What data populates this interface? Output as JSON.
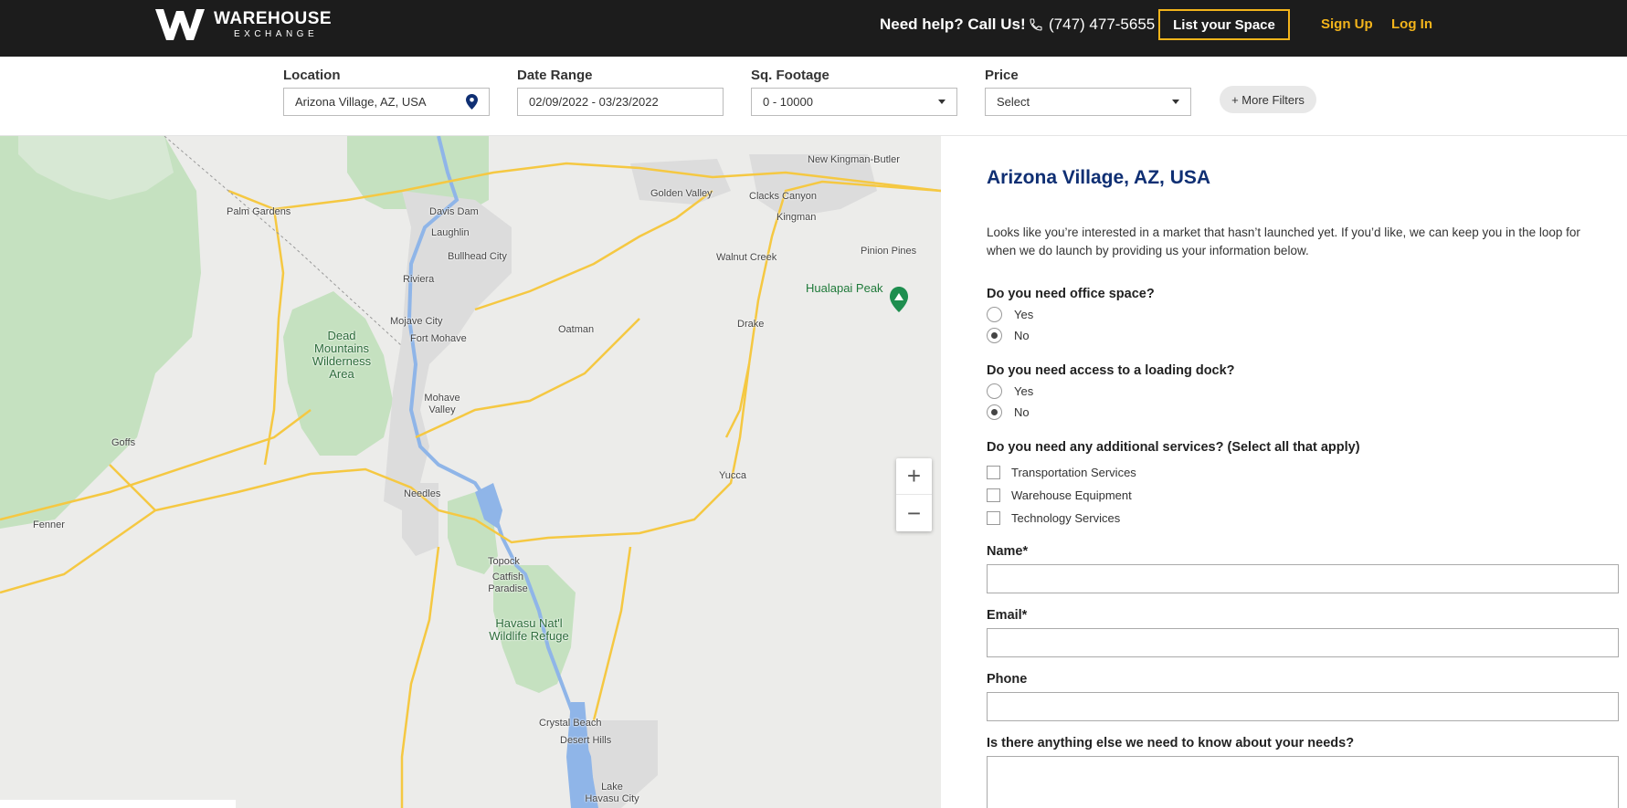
{
  "header": {
    "logo_line1": "WAREHOUSE",
    "logo_line2": "EXCHANGE",
    "help_text": "Need help? Call Us!",
    "phone": "(747) 477-5655",
    "list_space_label": "List your Space",
    "signup_label": "Sign Up",
    "login_label": "Log In",
    "accent_color": "#f3b41b"
  },
  "filters": {
    "location": {
      "label": "Location",
      "value": "Arizona Village, AZ, USA",
      "icon": "map-pin-icon"
    },
    "date_range": {
      "label": "Date Range",
      "value": "02/09/2022 - 03/23/2022"
    },
    "sq_footage": {
      "label": "Sq. Footage",
      "value": "0 - 10000"
    },
    "price": {
      "label": "Price",
      "value": "Select"
    },
    "more_filters_label": "+ More Filters"
  },
  "map": {
    "labels": {
      "new_kingman_butler": "New Kingman-Butler",
      "golden_valley": "Golden Valley",
      "clacks_canyon": "Clacks Canyon",
      "kingman": "Kingman",
      "palm_gardens": "Palm Gardens",
      "davis_dam": "Davis Dam",
      "laughlin": "Laughlin",
      "bullhead_city": "Bullhead City",
      "pinion_pines": "Pinion Pines",
      "walnut_creek": "Walnut Creek",
      "hualapai_peak": "Hualapai Peak",
      "riviera": "Riviera",
      "dead_mountains": "Dead Mountains Wilderness Area",
      "mojave_city": "Mojave City",
      "fort_mohave": "Fort Mohave",
      "oatman": "Oatman",
      "drake": "Drake",
      "mohave_valley": "Mohave Valley",
      "goffs": "Goffs",
      "yucca": "Yucca",
      "needles": "Needles",
      "fenner": "Fenner",
      "topock": "Topock",
      "catfish_paradise": "Catfish Paradise",
      "havasu_refuge": "Havasu Nat'l Wildlife Refuge",
      "crystal_beach": "Crystal Beach",
      "desert_hills": "Desert Hills",
      "lake_havasu_city": "Lake Havasu City"
    },
    "zoom_in": "+",
    "zoom_out": "−"
  },
  "form": {
    "title": "Arizona Village, AZ, USA",
    "intro": "Looks like you’re interested in a market that hasn’t launched yet. If you’d like, we can keep you in the loop for when we do launch by providing us your information below.",
    "office_question": "Do you need office space?",
    "office_options": [
      "Yes",
      "No"
    ],
    "office_selected": "No",
    "dock_question": "Do you need access to a loading dock?",
    "dock_options": [
      "Yes",
      "No"
    ],
    "dock_selected": "No",
    "services_question": "Do you need any additional services? (Select all that apply)",
    "services": [
      "Transportation Services",
      "Warehouse Equipment",
      "Technology Services"
    ],
    "name_label": "Name*",
    "email_label": "Email*",
    "phone_label": "Phone",
    "needs_label": "Is there anything else we need to know about your needs?",
    "title_color": "#0f2f73"
  }
}
